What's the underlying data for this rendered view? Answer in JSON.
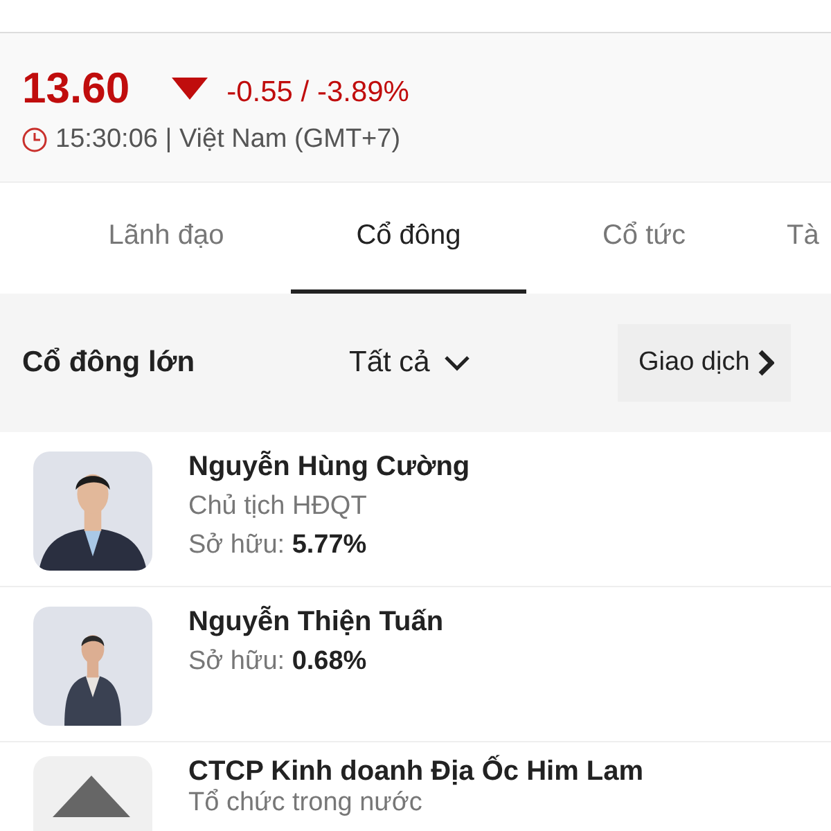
{
  "quote": {
    "price": "13.60",
    "falling": true,
    "change": "-0.55 / -3.89%",
    "time": "15:30:06 | Việt Nam (GMT+7)"
  },
  "tabs": [
    {
      "label": "Lãnh đạo",
      "selected": false
    },
    {
      "label": "Cổ đông",
      "selected": true
    },
    {
      "label": "Cổ tức",
      "selected": false
    },
    {
      "label": "Tà",
      "selected": false
    }
  ],
  "section": {
    "title": "Cổ đông lớn",
    "filter": "Tất cả",
    "link": "Giao dịch"
  },
  "holders": [
    {
      "kind": "person",
      "name": "Nguyễn Hùng Cường",
      "role": "Chủ tịch HĐQT",
      "share_label": "Sở hữu:",
      "share": "5.77%"
    },
    {
      "kind": "person",
      "name": "Nguyễn Thiện Tuấn",
      "share_label": "Sở hữu:",
      "share": "0.68%"
    },
    {
      "kind": "organization",
      "name": "CTCP Kinh doanh Địa Ốc Him Lam",
      "role": "Tổ chức trong nước"
    }
  ]
}
